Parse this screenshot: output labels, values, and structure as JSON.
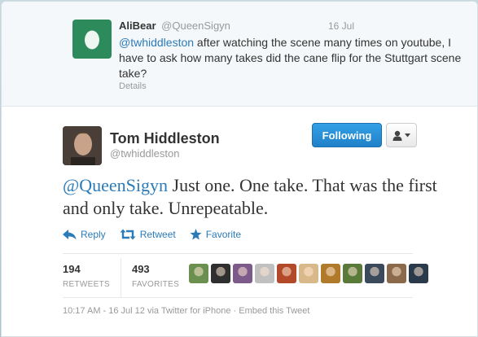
{
  "reply_to": {
    "name": "AliBear",
    "handle": "@QueenSigyn",
    "date": "16 Jul",
    "mention": "@twhiddleston",
    "text": " after watching the scene many times on youtube, I have to ask how many takes did the cane flip for the Stuttgart scene take?",
    "details_label": "Details"
  },
  "tweet": {
    "name": "Tom Hiddleston",
    "handle": "@twhiddleston",
    "follow_label": "Following",
    "mention": "@QueenSigyn",
    "text": " Just one. One take. That was the first and only take. Unrepeatable.",
    "actions": {
      "reply": "Reply",
      "retweet": "Retweet",
      "favorite": "Favorite"
    },
    "stats": {
      "retweets_count": "194",
      "retweets_label": "RETWEETS",
      "favorites_count": "493",
      "favorites_label": "FAVORITES"
    },
    "meta": "10:17 AM - 16 Jul 12 via Twitter for iPhone · Embed this Tweet"
  },
  "colors": {
    "link": "#2b7bb9",
    "follow_button": "#1f81c9",
    "egg_avatar": "#2d8b5b"
  },
  "favoriters": [
    {
      "color": "#6b8f4e"
    },
    {
      "color": "#2f2f2f"
    },
    {
      "color": "#7c5a8a"
    },
    {
      "color": "#c0c0c0"
    },
    {
      "color": "#b24a2a"
    },
    {
      "color": "#d9b98a"
    },
    {
      "color": "#b07a2a"
    },
    {
      "color": "#5a7a3a"
    },
    {
      "color": "#3a4a5a"
    },
    {
      "color": "#8a6a4a"
    },
    {
      "color": "#2a3a4a"
    }
  ]
}
